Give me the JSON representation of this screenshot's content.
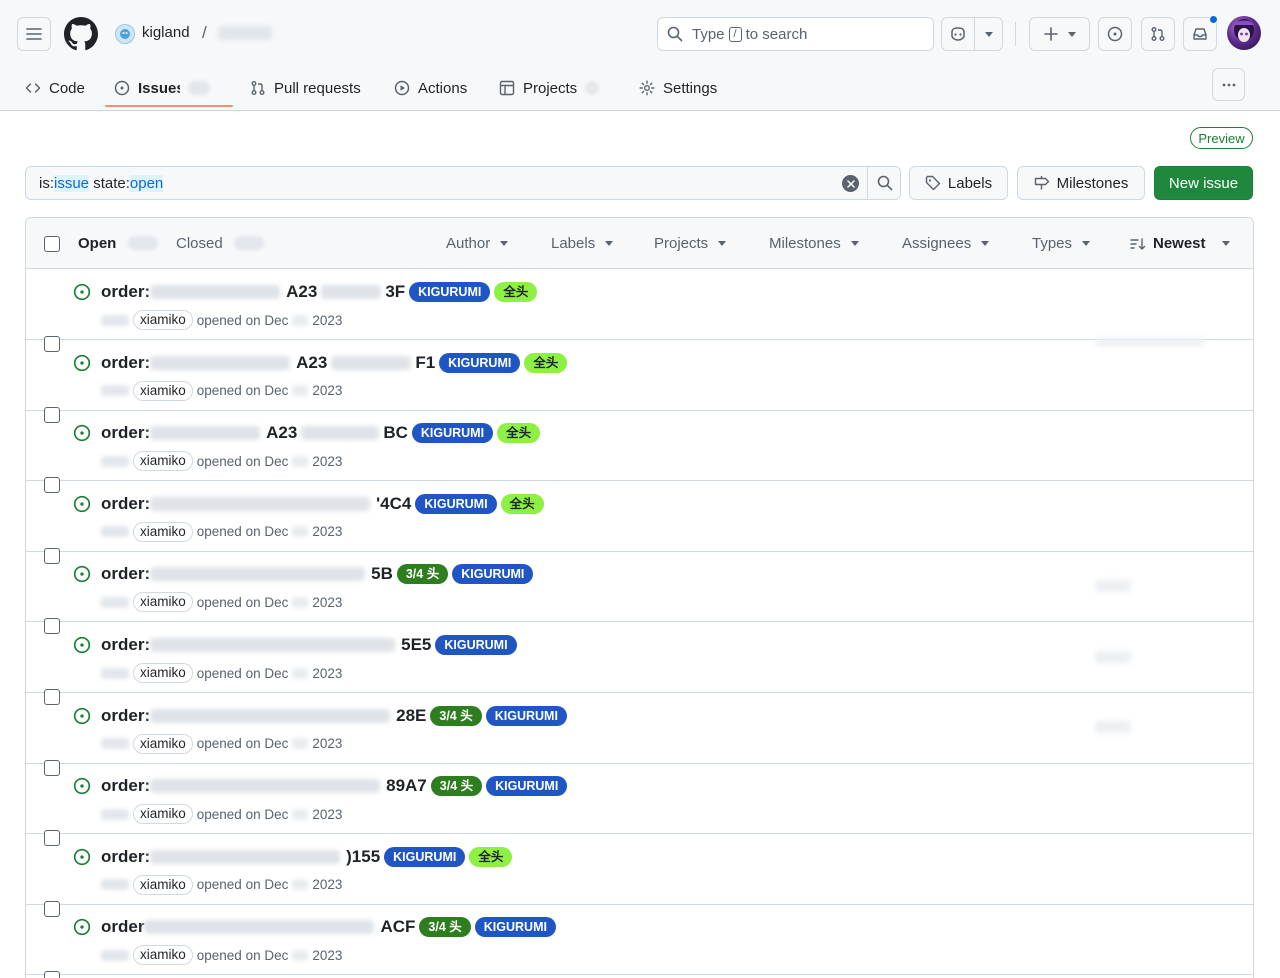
{
  "header": {
    "owner": "kigland",
    "crumb_separator": "/",
    "search_placeholder_before": "Type",
    "search_key": "/",
    "search_placeholder_after": "to search"
  },
  "tabs": [
    {
      "label": "Code",
      "icon": "code-icon"
    },
    {
      "label": "Issues",
      "icon": "issue-opened-icon",
      "selected": true
    },
    {
      "label": "Pull requests",
      "icon": "git-pull-request-icon"
    },
    {
      "label": "Actions",
      "icon": "play-icon"
    },
    {
      "label": "Projects",
      "icon": "table-icon"
    },
    {
      "label": "Settings",
      "icon": "gear-icon"
    }
  ],
  "toolbar": {
    "preview_badge": "Preview",
    "filter_prefix_1": "is:",
    "filter_value_1": "issue",
    "filter_prefix_2": " state:",
    "filter_value_2": "open",
    "labels_button": "Labels",
    "milestones_button": "Milestones",
    "new_issue_button": "New issue"
  },
  "list_header": {
    "open_label": "Open",
    "closed_label": "Closed",
    "filters": [
      "Author",
      "Labels",
      "Projects",
      "Milestones",
      "Assignees",
      "Types"
    ],
    "sort_label": "Newest"
  },
  "colors": {
    "kigurumi_bg": "#1f56c4",
    "quanto_bg": "#8ef043",
    "three_quarter_bg": "#2e7d1e",
    "open_green": "#1a7f37",
    "primary_button": "#1f883d",
    "tab_underline": "#fd8c73"
  },
  "issues": [
    {
      "title_prefix": "order:",
      "title_mid": "A23",
      "title_suffix": "3F",
      "labels": [
        {
          "text": "KIGURUMI",
          "color": "#1f56c4",
          "fg": "#ffffff"
        },
        {
          "text": "全头",
          "color": "#8ef043",
          "fg": "#1f2328"
        }
      ],
      "author": "xiamiko",
      "opened": "opened on Dec",
      "year": "2023"
    },
    {
      "title_prefix": "order:",
      "title_mid": "A23",
      "title_suffix": "F1",
      "labels": [
        {
          "text": "KIGURUMI",
          "color": "#1f56c4",
          "fg": "#ffffff"
        },
        {
          "text": "全头",
          "color": "#8ef043",
          "fg": "#1f2328"
        }
      ],
      "author": "xiamiko",
      "opened": "opened on Dec",
      "year": "2023"
    },
    {
      "title_prefix": "order:",
      "title_mid": "A23",
      "title_suffix": "BC",
      "labels": [
        {
          "text": "KIGURUMI",
          "color": "#1f56c4",
          "fg": "#ffffff"
        },
        {
          "text": "全头",
          "color": "#8ef043",
          "fg": "#1f2328"
        }
      ],
      "author": "xiamiko",
      "opened": "opened on Dec",
      "year": "2023"
    },
    {
      "title_prefix": "order:",
      "title_mid": "",
      "title_suffix": "'4C4",
      "labels": [
        {
          "text": "KIGURUMI",
          "color": "#1f56c4",
          "fg": "#ffffff"
        },
        {
          "text": "全头",
          "color": "#8ef043",
          "fg": "#1f2328"
        }
      ],
      "author": "xiamiko",
      "opened": "opened on Dec",
      "year": "2023"
    },
    {
      "title_prefix": "order:",
      "title_mid": "",
      "title_suffix": "5B",
      "labels": [
        {
          "text": "3/4 头",
          "color": "#2e7d1e",
          "fg": "#ffffff"
        },
        {
          "text": "KIGURUMI",
          "color": "#1f56c4",
          "fg": "#ffffff"
        }
      ],
      "author": "xiamiko",
      "opened": "opened on Dec",
      "year": "2023"
    },
    {
      "title_prefix": "order:",
      "title_mid": "",
      "title_suffix": "5E5",
      "labels": [
        {
          "text": "KIGURUMI",
          "color": "#1f56c4",
          "fg": "#ffffff"
        }
      ],
      "author": "xiamiko",
      "opened": "opened on Dec",
      "year": "2023"
    },
    {
      "title_prefix": "order:",
      "title_mid": "",
      "title_suffix": "28E",
      "labels": [
        {
          "text": "3/4 头",
          "color": "#2e7d1e",
          "fg": "#ffffff"
        },
        {
          "text": "KIGURUMI",
          "color": "#1f56c4",
          "fg": "#ffffff"
        }
      ],
      "author": "xiamiko",
      "opened": "opened on Dec",
      "year": "2023"
    },
    {
      "title_prefix": "order:",
      "title_mid": "",
      "title_suffix": "89A7",
      "labels": [
        {
          "text": "3/4 头",
          "color": "#2e7d1e",
          "fg": "#ffffff"
        },
        {
          "text": "KIGURUMI",
          "color": "#1f56c4",
          "fg": "#ffffff"
        }
      ],
      "author": "xiamiko",
      "opened": "opened on Dec",
      "year": "2023"
    },
    {
      "title_prefix": "order:",
      "title_mid": "",
      "title_suffix": ")155",
      "labels": [
        {
          "text": "KIGURUMI",
          "color": "#1f56c4",
          "fg": "#ffffff"
        },
        {
          "text": "全头",
          "color": "#8ef043",
          "fg": "#1f2328"
        }
      ],
      "author": "xiamiko",
      "opened": "opened on Dec",
      "year": "2023"
    },
    {
      "title_prefix": "order",
      "title_mid": "",
      "title_suffix": "ACF",
      "labels": [
        {
          "text": "3/4 头",
          "color": "#2e7d1e",
          "fg": "#ffffff"
        },
        {
          "text": "KIGURUMI",
          "color": "#1f56c4",
          "fg": "#ffffff"
        }
      ],
      "author": "xiamiko",
      "opened": "opened on Dec",
      "year": "2023"
    }
  ]
}
